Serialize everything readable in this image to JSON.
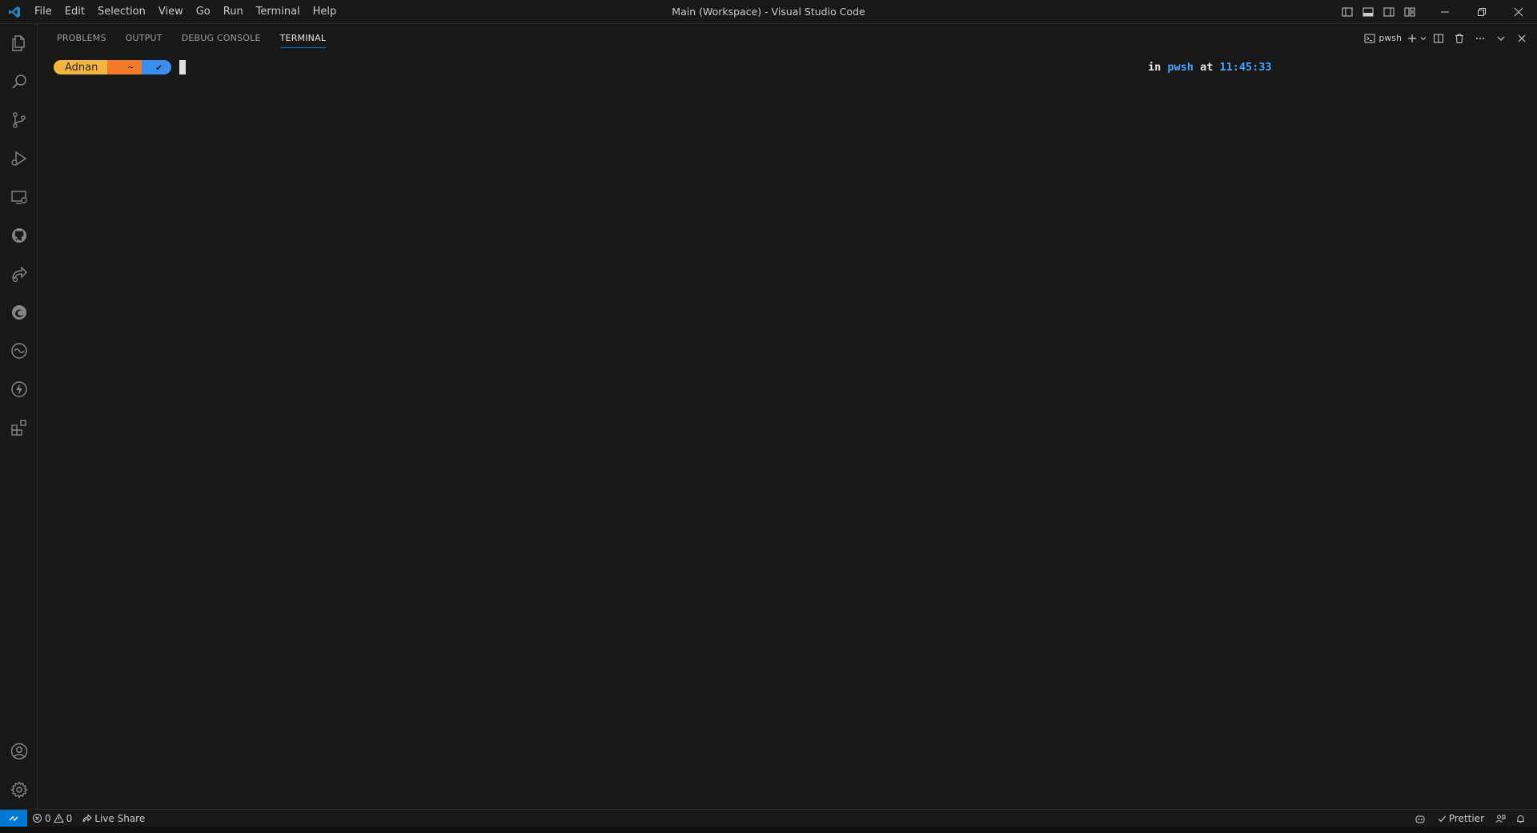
{
  "window": {
    "title": "Main (Workspace) - Visual Studio Code"
  },
  "menubar": {
    "items": [
      "File",
      "Edit",
      "Selection",
      "View",
      "Go",
      "Run",
      "Terminal",
      "Help"
    ]
  },
  "activitybar": {
    "items": [
      {
        "name": "explorer-icon"
      },
      {
        "name": "search-icon"
      },
      {
        "name": "source-control-icon"
      },
      {
        "name": "run-debug-icon"
      },
      {
        "name": "remote-explorer-icon"
      },
      {
        "name": "github-icon"
      },
      {
        "name": "live-share-icon"
      },
      {
        "name": "edge-icon"
      },
      {
        "name": "wave-icon"
      },
      {
        "name": "lightning-icon"
      },
      {
        "name": "extensions-icon"
      }
    ],
    "bottom": [
      {
        "name": "accounts-icon"
      },
      {
        "name": "manage-gear-icon"
      }
    ]
  },
  "panel": {
    "tabs": [
      {
        "label": "PROBLEMS",
        "active": false
      },
      {
        "label": "OUTPUT",
        "active": false
      },
      {
        "label": "DEBUG CONSOLE",
        "active": false
      },
      {
        "label": "TERMINAL",
        "active": true
      }
    ],
    "terminal_name": "pwsh"
  },
  "terminal": {
    "prompt": {
      "user": "Adnan",
      "path_glyph": "",
      "path": "~",
      "status": "✔"
    },
    "right_prompt": {
      "in": "in",
      "shell": "pwsh",
      "at": "at",
      "time": "11:45:33"
    }
  },
  "statusbar": {
    "errors": "0",
    "warnings": "0",
    "live_share": "Live Share",
    "prettier": "Prettier"
  },
  "colors": {
    "accent": "#0078d4",
    "prompt_user_bg": "#f4b63f",
    "prompt_path_bg": "#f37a28",
    "prompt_status_bg": "#3b8ef0",
    "time_color": "#4aa3ff"
  }
}
